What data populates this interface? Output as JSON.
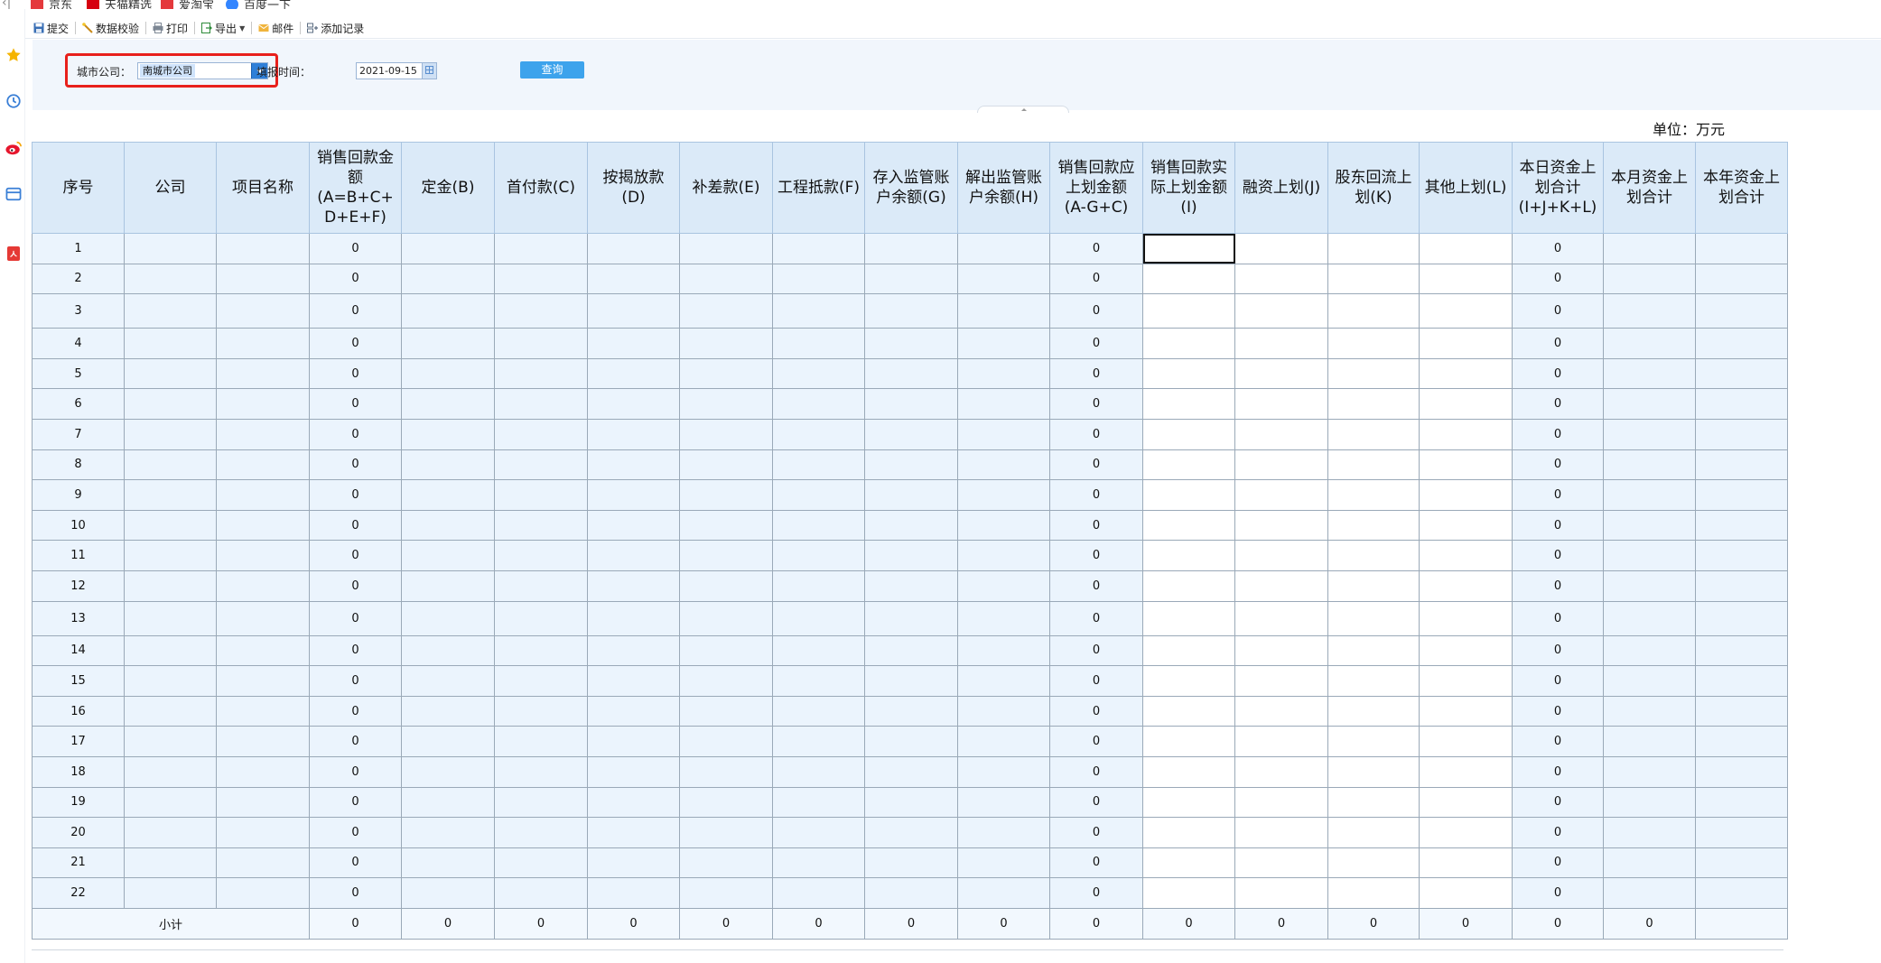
{
  "bookmarks": [
    {
      "label": "京东",
      "color": "#e4393c",
      "icon": "jd-icon"
    },
    {
      "label": "天猫精选",
      "color": "#d6000f",
      "icon": "tmall-icon"
    },
    {
      "label": "爱淘宝",
      "color": "#e4393c",
      "icon": "aitaobao-icon"
    },
    {
      "label": "百度一下",
      "color": "#3385ff",
      "icon": "baidu-icon"
    }
  ],
  "toolbar": {
    "submit": "提交",
    "validate": "数据校验",
    "print": "打印",
    "export": "导出",
    "mail": "邮件",
    "add_record": "添加记录"
  },
  "query": {
    "company_label": "城市公司：",
    "company_value": "南城市公司",
    "date_label": "填报时间：",
    "date_value": "2021-09-15",
    "query_button": "查询"
  },
  "unit_label": "单位：万元",
  "table": {
    "headers": [
      "序号",
      "公司",
      "项目名称",
      "销售回款金额(A=B+C+D+E+F)",
      "定金(B)",
      "首付款(C)",
      "按揭放款(D)",
      "补差款(E)",
      "工程抵款(F)",
      "存入监管账户余额(G)",
      "解出监管账户余额(H)",
      "销售回款应上划金额(A-G+C)",
      "销售回款实际上划金额(I)",
      "融资上划(J)",
      "股东回流上划(K)",
      "其他上划(L)",
      "本日资金上划合计(I+J+K+L)",
      "本月资金上划合计",
      "本年资金上划合计"
    ],
    "header_lines": [
      [
        "序号"
      ],
      [
        "公司"
      ],
      [
        "项目名称"
      ],
      [
        "销售回款金",
        "额",
        "(A=B+C+",
        "D+E+F)"
      ],
      [
        "定金(B)"
      ],
      [
        "首付款(C)"
      ],
      [
        "按揭放款",
        "(D)"
      ],
      [
        "补差款(E)"
      ],
      [
        "工程抵款(F)"
      ],
      [
        "存入监管账",
        "户余额(G)"
      ],
      [
        "解出监管账",
        "户余额(H)"
      ],
      [
        "销售回款应",
        "上划金额",
        "(A-G+C)"
      ],
      [
        "销售回款实",
        "际上划金额",
        "(I)"
      ],
      [
        "融资上划(J)"
      ],
      [
        "股东回流上",
        "划(K)"
      ],
      [
        "其他上划(L)"
      ],
      [
        "本日资金上",
        "划合计",
        "(I+J+K+L)"
      ],
      [
        "本月资金上",
        "划合计"
      ],
      [
        "本年资金上",
        "划合计"
      ]
    ],
    "rows": [
      {
        "no": "1",
        "a": "0",
        "agc": "0",
        "day": "0"
      },
      {
        "no": "2",
        "a": "0",
        "agc": "0",
        "day": "0"
      },
      {
        "no": "3",
        "a": "0",
        "agc": "0",
        "day": "0"
      },
      {
        "no": "4",
        "a": "0",
        "agc": "0",
        "day": "0"
      },
      {
        "no": "5",
        "a": "0",
        "agc": "0",
        "day": "0"
      },
      {
        "no": "6",
        "a": "0",
        "agc": "0",
        "day": "0"
      },
      {
        "no": "7",
        "a": "0",
        "agc": "0",
        "day": "0"
      },
      {
        "no": "8",
        "a": "0",
        "agc": "0",
        "day": "0"
      },
      {
        "no": "9",
        "a": "0",
        "agc": "0",
        "day": "0"
      },
      {
        "no": "10",
        "a": "0",
        "agc": "0",
        "day": "0"
      },
      {
        "no": "11",
        "a": "0",
        "agc": "0",
        "day": "0"
      },
      {
        "no": "12",
        "a": "0",
        "agc": "0",
        "day": "0"
      },
      {
        "no": "13",
        "a": "0",
        "agc": "0",
        "day": "0"
      },
      {
        "no": "14",
        "a": "0",
        "agc": "0",
        "day": "0"
      },
      {
        "no": "15",
        "a": "0",
        "agc": "0",
        "day": "0"
      },
      {
        "no": "16",
        "a": "0",
        "agc": "0",
        "day": "0"
      },
      {
        "no": "17",
        "a": "0",
        "agc": "0",
        "day": "0"
      },
      {
        "no": "18",
        "a": "0",
        "agc": "0",
        "day": "0"
      },
      {
        "no": "19",
        "a": "0",
        "agc": "0",
        "day": "0"
      },
      {
        "no": "20",
        "a": "0",
        "agc": "0",
        "day": "0"
      },
      {
        "no": "21",
        "a": "0",
        "agc": "0",
        "day": "0"
      },
      {
        "no": "22",
        "a": "0",
        "agc": "0",
        "day": "0"
      }
    ],
    "subtotal": {
      "label": "小计",
      "values": [
        "0",
        "0",
        "0",
        "0",
        "0",
        "0",
        "0",
        "0",
        "0",
        "0",
        "0",
        "0",
        "0",
        "0",
        "0"
      ]
    }
  },
  "colors": {
    "header_bg": "#dbeaf8",
    "cell_blue": "#ebf4fd",
    "query_button": "#3da3ec",
    "highlight_box": "#e8201b"
  }
}
